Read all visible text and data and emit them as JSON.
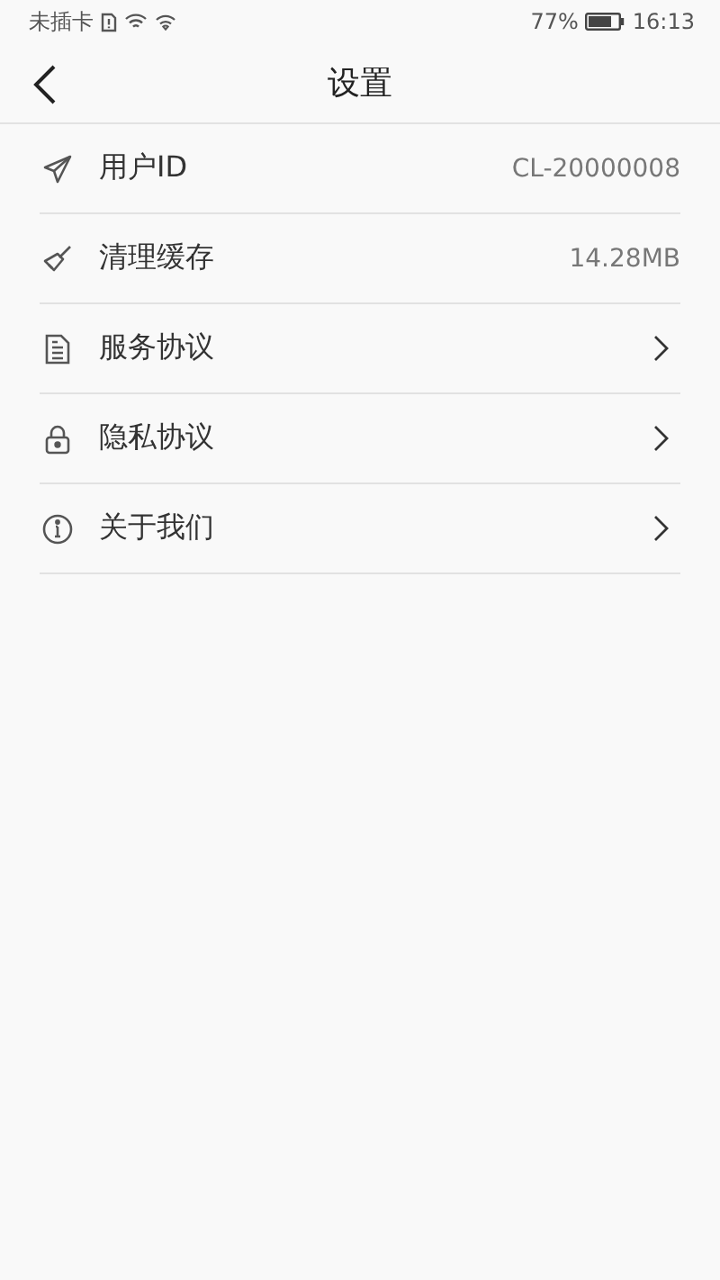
{
  "status_bar": {
    "carrier": "未插卡",
    "battery_percent": "77%",
    "time": "16:13"
  },
  "header": {
    "title": "设置"
  },
  "rows": [
    {
      "kind": "value",
      "label": "用户ID",
      "value": "CL-20000008"
    },
    {
      "kind": "value",
      "label": "清理缓存",
      "value": "14.28MB"
    },
    {
      "kind": "link",
      "label": "服务协议"
    },
    {
      "kind": "link",
      "label": "隐私协议"
    },
    {
      "kind": "link",
      "label": "关于我们"
    }
  ]
}
